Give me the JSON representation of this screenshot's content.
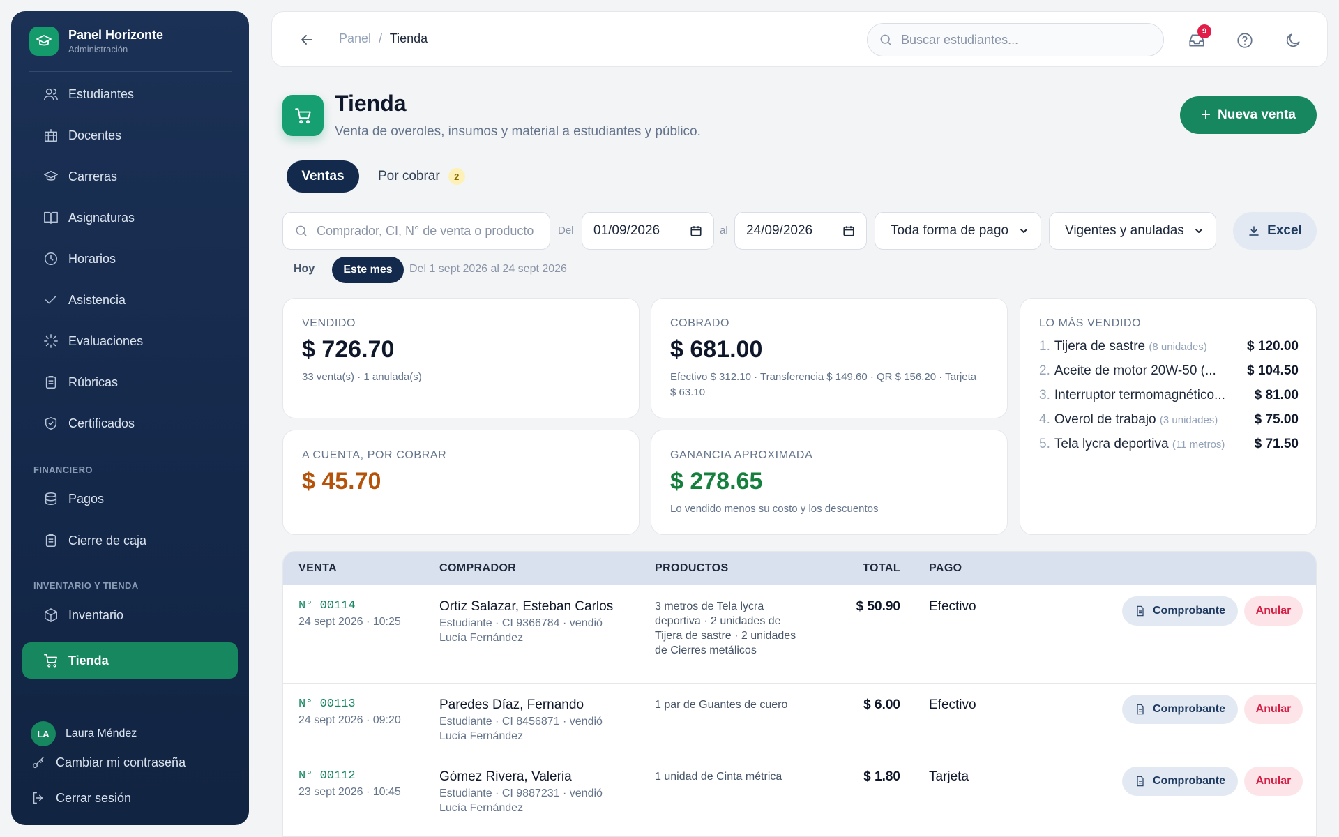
{
  "brand": {
    "title": "Panel Horizonte",
    "subtitle": "Administración"
  },
  "sidebar": {
    "items": [
      {
        "label": "Estudiantes",
        "icon": "users-icon"
      },
      {
        "label": "Docentes",
        "icon": "building-icon"
      },
      {
        "label": "Carreras",
        "icon": "graduation-cap-icon"
      },
      {
        "label": "Asignaturas",
        "icon": "book-open-icon"
      },
      {
        "label": "Horarios",
        "icon": "clock-icon"
      },
      {
        "label": "Asistencia",
        "icon": "check-icon"
      },
      {
        "label": "Evaluaciones",
        "icon": "loader-icon"
      },
      {
        "label": "Rúbricas",
        "icon": "clipboard-icon"
      },
      {
        "label": "Certificados",
        "icon": "shield-check-icon"
      }
    ],
    "section_financiero": "FINANCIERO",
    "financiero_items": [
      {
        "label": "Pagos",
        "icon": "database-icon"
      },
      {
        "label": "Cierre de caja",
        "icon": "clipboard-icon"
      }
    ],
    "section_inventario": "INVENTARIO Y TIENDA",
    "inventario_items": [
      {
        "label": "Inventario",
        "icon": "box-icon"
      },
      {
        "label": "Tienda",
        "icon": "cart-icon",
        "active": true
      }
    ],
    "user": {
      "initials": "LA",
      "name": "Laura Méndez"
    },
    "change_password": "Cambiar mi contraseña",
    "logout": "Cerrar sesión"
  },
  "topbar": {
    "breadcrumb_root": "Panel",
    "breadcrumb_sep": "/",
    "breadcrumb_current": "Tienda",
    "search_placeholder": "Buscar estudiantes...",
    "notifications_count": "9"
  },
  "header": {
    "title": "Tienda",
    "subtitle": "Venta de overoles, insumos y material a estudiantes y público.",
    "new_sale_label": "Nueva venta"
  },
  "tabs": {
    "ventas": "Ventas",
    "por_cobrar": "Por cobrar",
    "por_cobrar_count": "2"
  },
  "filters": {
    "search_placeholder": "Comprador, CI, N° de venta o producto",
    "from_label": "Del",
    "from_date": "01/09/2026",
    "to_label": "al",
    "to_date": "24/09/2026",
    "payment_select": "Toda forma de pago",
    "status_select": "Vigentes y anuladas",
    "excel_label": "Excel",
    "quick_today": "Hoy",
    "quick_month": "Este mes",
    "range_text": "Del 1 sept 2026 al 24 sept 2026"
  },
  "cards": {
    "vendido": {
      "label": "VENDIDO",
      "value": "$ 726.70",
      "note": "33 venta(s) · 1 anulada(s)"
    },
    "cobrado": {
      "label": "COBRADO",
      "value": "$ 681.00",
      "note": "Efectivo $ 312.10 · Transferencia $ 149.60 · QR $ 156.20 · Tarjeta $ 63.10"
    },
    "por_cobrar": {
      "label": "A CUENTA, POR COBRAR",
      "value": "$ 45.70"
    },
    "ganancia": {
      "label": "GANANCIA APROXIMADA",
      "value": "$ 278.65",
      "note": "Lo vendido menos su costo y los descuentos"
    },
    "top": {
      "label": "LO MÁS VENDIDO",
      "items": [
        {
          "num": "1.",
          "name": "Tijera de sastre",
          "unit": "(8 unidades)",
          "amount": "$ 120.00"
        },
        {
          "num": "2.",
          "name": "Aceite de motor 20W-50 (...",
          "unit": "",
          "amount": "$ 104.50"
        },
        {
          "num": "3.",
          "name": "Interruptor termomagnético...",
          "unit": "",
          "amount": "$ 81.00"
        },
        {
          "num": "4.",
          "name": "Overol de trabajo",
          "unit": "(3 unidades)",
          "amount": "$ 75.00"
        },
        {
          "num": "5.",
          "name": "Tela lycra deportiva",
          "unit": "(11 metros)",
          "amount": "$ 71.50"
        }
      ]
    }
  },
  "table": {
    "headers": {
      "venta": "VENTA",
      "comprador": "COMPRADOR",
      "productos": "PRODUCTOS",
      "total": "TOTAL",
      "pago": "PAGO"
    },
    "comprobante_label": "Comprobante",
    "anular_label": "Anular",
    "rows": [
      {
        "num": "N° 00114",
        "date": "24 sept 2026 · 10:25",
        "buyer": "Ortiz Salazar, Esteban Carlos",
        "meta": "Estudiante · CI 9366784 · vendió Lucía Fernández",
        "products": "3 metros de Tela lycra deportiva · 2 unidades de Tijera de sastre · 2 unidades de Cierres metálicos",
        "total": "$ 50.90",
        "pay": "Efectivo"
      },
      {
        "num": "N° 00113",
        "date": "24 sept 2026 · 09:20",
        "buyer": "Paredes Díaz, Fernando",
        "meta": "Estudiante · CI 8456871 · vendió Lucía Fernández",
        "products": "1 par de Guantes de cuero",
        "total": "$ 6.00",
        "pay": "Efectivo"
      },
      {
        "num": "N° 00112",
        "date": "23 sept 2026 · 10:45",
        "buyer": "Gómez Rivera, Valeria",
        "meta": "Estudiante · CI 9887231 · vendió Lucía Fernández",
        "products": "1 unidad de Cinta métrica",
        "total": "$ 1.80",
        "pay": "Tarjeta"
      }
    ]
  },
  "colors": {
    "accent": "#16875f",
    "navy": "#142a4d",
    "warning": "#b45309",
    "success": "#15803d",
    "danger": "#d61f45"
  }
}
